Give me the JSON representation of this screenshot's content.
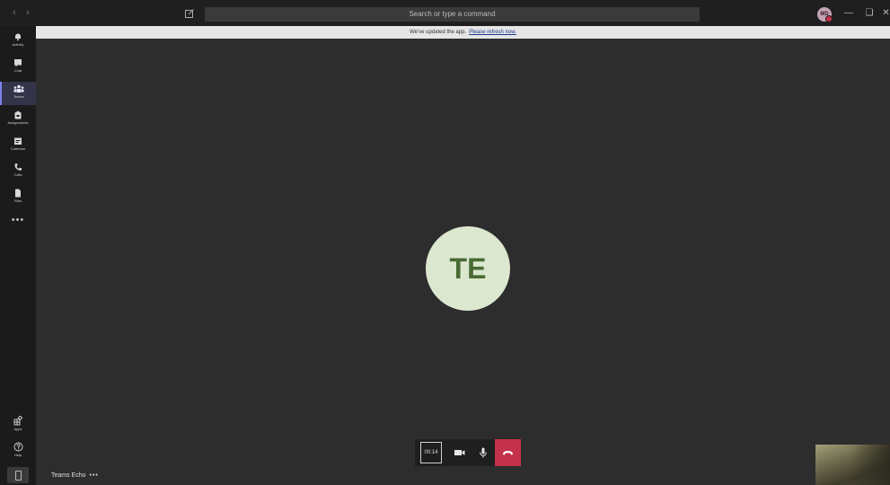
{
  "titlebar": {
    "search_placeholder": "Search or type a command",
    "avatar_initials": "MD"
  },
  "banner": {
    "message": "We've updated the app.",
    "link_text": "Please refresh now."
  },
  "rail": {
    "items": [
      {
        "label": "Activity",
        "icon": "bell-icon"
      },
      {
        "label": "Chat",
        "icon": "chat-icon"
      },
      {
        "label": "Teams",
        "icon": "teams-icon",
        "active": true
      },
      {
        "label": "Assignments",
        "icon": "assignments-icon"
      },
      {
        "label": "Calendar",
        "icon": "calendar-icon"
      },
      {
        "label": "Calls",
        "icon": "phone-icon"
      },
      {
        "label": "Files",
        "icon": "file-icon"
      }
    ],
    "bottom_items": [
      {
        "label": "Apps",
        "icon": "apps-icon"
      },
      {
        "label": "Help",
        "icon": "help-icon"
      }
    ]
  },
  "call": {
    "participant_initials": "TE",
    "timer": "00:14",
    "name": "Teams Echo"
  },
  "colors": {
    "accent": "#7b83eb",
    "hangup": "#c4314b",
    "avatar_bg": "#dce7cf",
    "avatar_text": "#4a6b34"
  }
}
